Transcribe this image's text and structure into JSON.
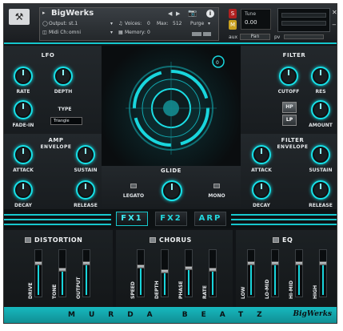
{
  "header": {
    "instrument_name": "BigWerks",
    "output_label": "Output:",
    "output_value": "st.1",
    "voices_label": "Voices:",
    "voices_value": "0",
    "max_label": "Max:",
    "max_value": "512",
    "purge_label": "Purge",
    "midi_label": "Midi Ch:",
    "midi_value": "omni",
    "memory_label": "Memory:",
    "memory_value": "0",
    "tune_label": "Tune",
    "tune_value": "0.00",
    "s_label": "S",
    "m_label": "M",
    "aux_label": "aux",
    "pv_label": "pv",
    "pan_label": "Pan"
  },
  "lfo": {
    "title": "LFO",
    "rate": "RATE",
    "depth": "DEPTH",
    "fade_in": "FADE-IN",
    "type_label": "TYPE",
    "type_value": "Triangle"
  },
  "filter_top": {
    "title": "FILTER",
    "cutoff": "CUTOFF",
    "res": "RES",
    "hp": "HP",
    "lp": "LP",
    "amount": "AMOUNT"
  },
  "amp": {
    "title": "AMP",
    "subtitle": "ENVELOPE",
    "attack": "ATTACK",
    "sustain": "SUSTAIN",
    "decay": "DECAY",
    "release": "RELEASE"
  },
  "filter_env": {
    "title": "FILTER",
    "subtitle": "ENVELOPE",
    "attack": "ATTACK",
    "sustain": "SUSTAIN",
    "decay": "DECAY",
    "release": "RELEASE"
  },
  "glide": {
    "title": "GLIDE",
    "legato": "LEGATO",
    "mono": "MONO"
  },
  "tabs": [
    "FX1",
    "FX2",
    "ARP"
  ],
  "fx": {
    "distortion": {
      "title": "DISTORTION",
      "labels": [
        "DRIVE",
        "TONE",
        "OUTPUT"
      ]
    },
    "chorus": {
      "title": "CHORUS",
      "labels": [
        "SPEED",
        "DEPTH",
        "PHASE",
        "RATE"
      ]
    },
    "eq": {
      "title": "EQ",
      "labels": [
        "LOW",
        "LO-MID",
        "HI-MID",
        "HIGH"
      ]
    }
  },
  "footer": {
    "text": "MURDA BEATZ",
    "brand": "BigWerks"
  },
  "colors": {
    "accent": "#17c6cc",
    "background": "#111417"
  }
}
